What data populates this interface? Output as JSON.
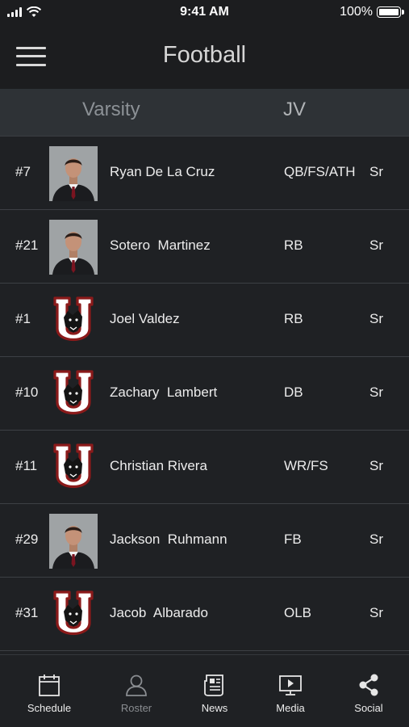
{
  "status_bar": {
    "time": "9:41 AM",
    "battery": "100%"
  },
  "header": {
    "title": "Football"
  },
  "tabs": [
    {
      "label": "Varsity"
    },
    {
      "label": "JV"
    }
  ],
  "roster": [
    {
      "number": "#7",
      "name": "Ryan De La Cruz",
      "position": "QB/FS/ATH",
      "year": "Sr",
      "image": "player-photo"
    },
    {
      "number": "#21",
      "name": "Sotero  Martinez",
      "position": "RB",
      "year": "Sr",
      "image": "player-photo"
    },
    {
      "number": "#1",
      "name": "Joel Valdez",
      "position": "RB",
      "year": "Sr",
      "image": "team-logo"
    },
    {
      "number": "#10",
      "name": "Zachary  Lambert",
      "position": "DB",
      "year": "Sr",
      "image": "team-logo"
    },
    {
      "number": "#11",
      "name": "Christian Rivera",
      "position": "WR/FS",
      "year": "Sr",
      "image": "team-logo"
    },
    {
      "number": "#29",
      "name": "Jackson  Ruhmann",
      "position": "FB",
      "year": "Sr",
      "image": "player-photo"
    },
    {
      "number": "#31",
      "name": "Jacob  Albarado",
      "position": "OLB",
      "year": "Sr",
      "image": "team-logo"
    }
  ],
  "tab_bar": [
    {
      "label": "Schedule",
      "icon": "calendar-icon"
    },
    {
      "label": "Roster",
      "icon": "person-icon"
    },
    {
      "label": "News",
      "icon": "newspaper-icon"
    },
    {
      "label": "Media",
      "icon": "media-play-icon"
    },
    {
      "label": "Social",
      "icon": "share-icon"
    }
  ],
  "colors": {
    "background": "#1f2124",
    "tabs_background": "#2e3236",
    "logo_red": "#8b1a1a"
  }
}
